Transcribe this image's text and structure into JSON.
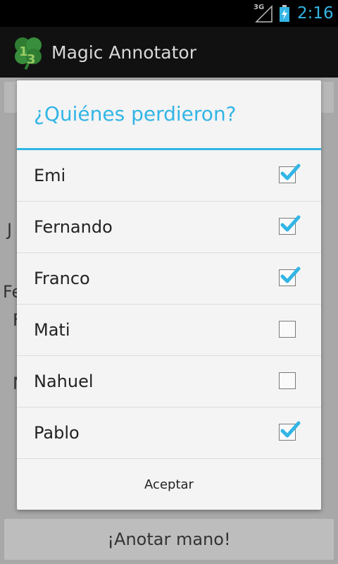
{
  "status_bar": {
    "network": "3G",
    "time": "2:16"
  },
  "action_bar": {
    "title": "Magic Annotator",
    "icon": "clover-app-icon"
  },
  "background": {
    "peek_letters": [
      "J",
      "Fe",
      "F",
      "N"
    ],
    "anotar_button_label": "¡Anotar mano!"
  },
  "dialog": {
    "title": "¿Quiénes perdieron?",
    "items": [
      {
        "label": "Emi",
        "checked": true
      },
      {
        "label": "Fernando",
        "checked": true
      },
      {
        "label": "Franco",
        "checked": true
      },
      {
        "label": "Mati",
        "checked": false
      },
      {
        "label": "Nahuel",
        "checked": false
      },
      {
        "label": "Pablo",
        "checked": true
      }
    ],
    "accept_label": "Aceptar"
  },
  "colors": {
    "accent": "#33b5e5",
    "dialog_bg": "#f4f4f4",
    "dim_bg": "#a8a8a8"
  }
}
